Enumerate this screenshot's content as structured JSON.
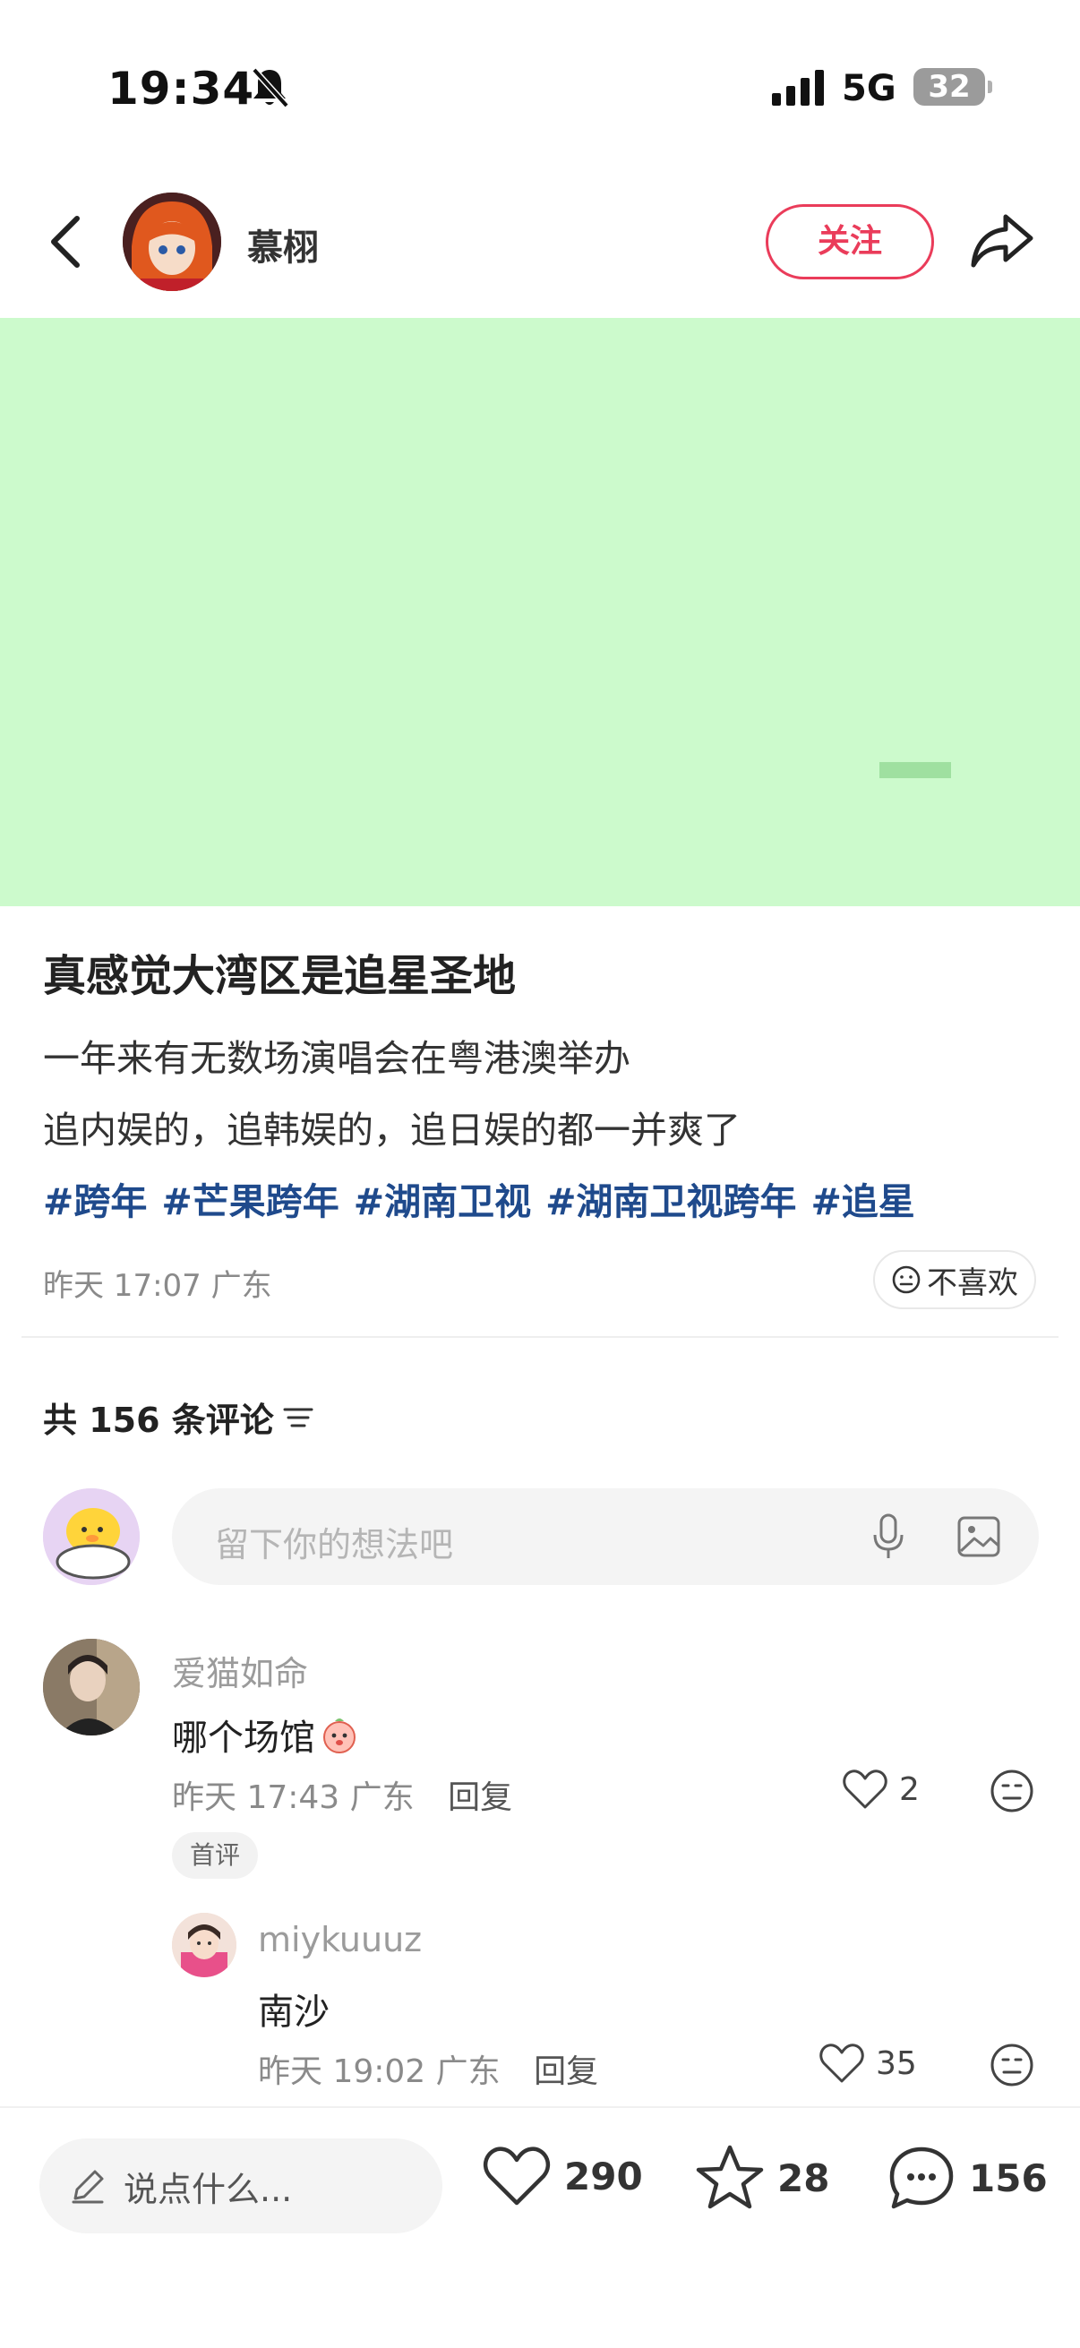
{
  "status": {
    "time": "19:34",
    "network": "5G",
    "battery": "32",
    "bell_icon": "bell-muted-icon",
    "signal_icon": "signal-bars-icon"
  },
  "header": {
    "author": "慕栩",
    "follow_label": "关注",
    "back_icon": "chevron-left-icon",
    "share_icon": "share-arrow-icon"
  },
  "media": {
    "background": "#ccfacc"
  },
  "post": {
    "title": "真感觉大湾区是追星圣地",
    "lines": [
      "一年来有无数场演唱会在粤港澳举办",
      "追内娱的，追韩娱的，追日娱的都一并爽了"
    ],
    "tags": [
      "#跨年",
      "#芒果跨年",
      "#湖南卫视",
      "#湖南卫视跨年",
      "#追星"
    ],
    "meta": "昨天 17:07 广东",
    "dislike_label": "不喜欢",
    "tag_color": "#1f4a8c"
  },
  "comments": {
    "count_label": "共 156 条评论",
    "input_placeholder": "留下你的想法吧",
    "items": [
      {
        "user": "爱猫如命",
        "text": "哪个场馆",
        "time": "昨天 17:43 广东",
        "reply_label": "回复",
        "likes": "2",
        "badge": "首评"
      },
      {
        "user": "miykuuuz",
        "text": "南沙",
        "time": "昨天 19:02 广东",
        "reply_label": "回复",
        "likes": "35"
      }
    ]
  },
  "bottom": {
    "say_placeholder": "说点什么...",
    "likes": "290",
    "favorites": "28",
    "comments": "156"
  },
  "colors": {
    "accent": "#ea3c5a",
    "tag": "#1f4a8c"
  }
}
